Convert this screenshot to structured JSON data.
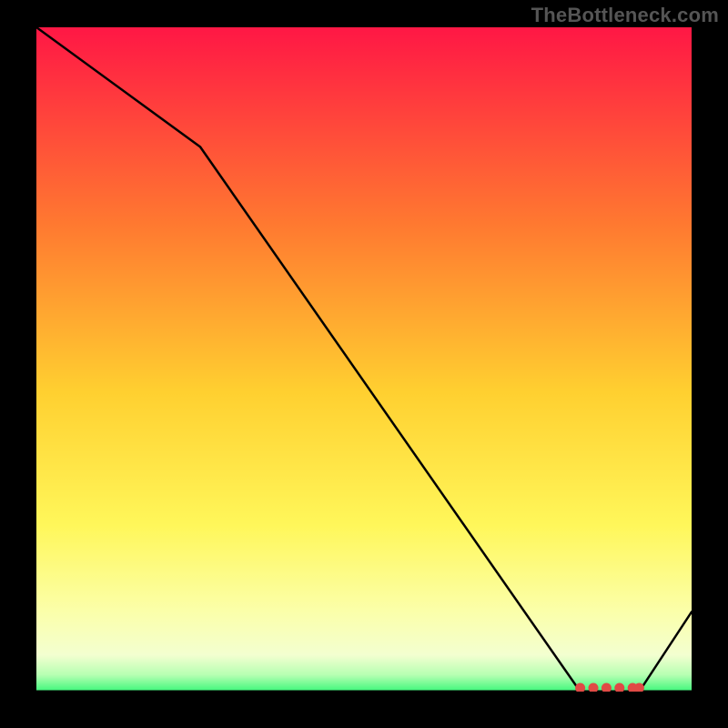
{
  "attribution": "TheBottleneck.com",
  "chart_data": {
    "type": "line",
    "title": "",
    "xlabel": "",
    "ylabel": "",
    "xlim": [
      0,
      100
    ],
    "ylim": [
      0,
      100
    ],
    "x": [
      0,
      25,
      83,
      92,
      100
    ],
    "y": [
      100,
      82,
      0,
      0,
      12
    ],
    "markers": {
      "x": [
        83,
        85,
        87,
        89,
        91,
        92
      ],
      "y": [
        0,
        0,
        0,
        0,
        0,
        0
      ]
    },
    "background_gradient": {
      "stops": [
        {
          "offset": 0.0,
          "color": "#ff1745"
        },
        {
          "offset": 0.3,
          "color": "#ff7a30"
        },
        {
          "offset": 0.55,
          "color": "#ffd030"
        },
        {
          "offset": 0.75,
          "color": "#fff75a"
        },
        {
          "offset": 0.88,
          "color": "#fbffaa"
        },
        {
          "offset": 0.945,
          "color": "#f3ffd0"
        },
        {
          "offset": 0.975,
          "color": "#b6ffb2"
        },
        {
          "offset": 1.0,
          "color": "#3cf77a"
        }
      ]
    }
  }
}
